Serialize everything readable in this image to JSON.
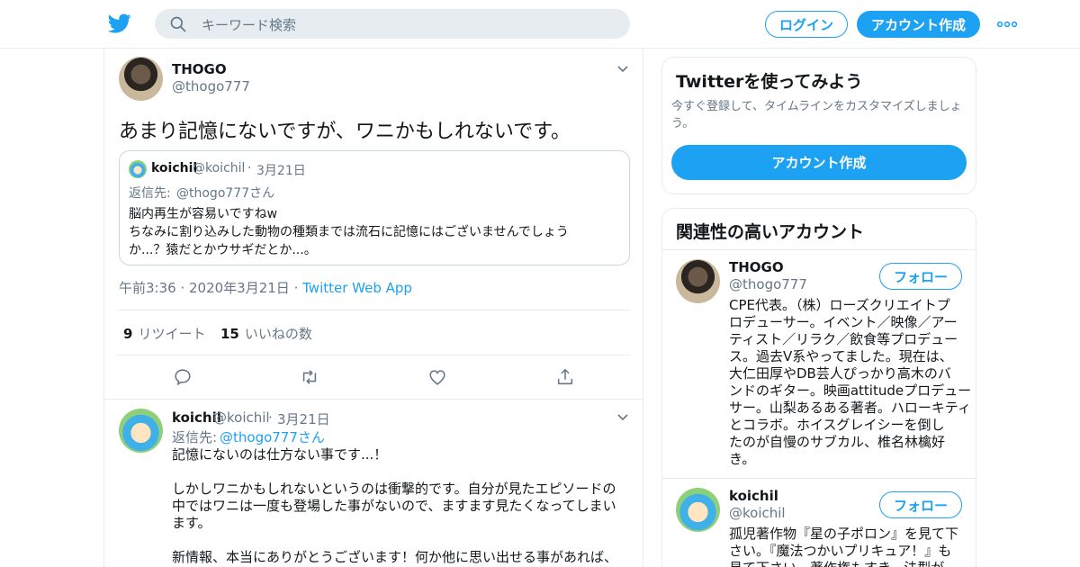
{
  "header": {
    "search_placeholder": "キーワード検索",
    "login_label": "ログイン",
    "signup_label": "アカウント作成"
  },
  "tweet": {
    "author_name": "THOGO",
    "author_handle": "@thogo777",
    "text": "あまり記憶にないですが、ワニかもしれないです。",
    "quote": {
      "name": "koichil",
      "handle": "@koichil",
      "date": "3月21日",
      "reply_prefix": "返信先: ",
      "reply_to": "@thogo777さん",
      "lines": [
        "脳内再生が容易いですねw",
        "ちなみに割り込みした動物の種類までは流石に記憶にはございませんでしょう",
        "か...？猿だとかウサギだとか...。"
      ]
    },
    "time": "午前3:36",
    "date": "2020年3月21日",
    "source": "Twitter Web App",
    "retweet_count": "9",
    "retweet_label": "リツイート",
    "like_count": "15",
    "like_label": "いいねの数"
  },
  "reply": {
    "name": "koichil",
    "handle": "@koichil",
    "date": "3月21日",
    "reply_prefix": "返信先: ",
    "reply_to": "@thogo777さん",
    "lines": [
      "記憶にないのは仕方ない事です...！",
      "",
      "しかしワニかもしれないというのは衝撃的です。自分が見たエピソードの",
      "中ではワニは一度も登場した事がないので、ますます見たくなってしまい",
      "ます。",
      "",
      "新情報、本当にありがとうございます！何か他に思い出せる事があれば、"
    ]
  },
  "sidebar": {
    "signup_card": {
      "title": "Twitterを使ってみよう",
      "desc_lines": [
        "今すぐ登録して、タイムラインをカスタマイズしましょ",
        "う。"
      ],
      "button": "アカウント作成"
    },
    "related": {
      "title": "関連性の高いアカウント",
      "follow_label": "フォロー",
      "accounts": [
        {
          "name": "THOGO",
          "handle": "@thogo777",
          "bio_lines": [
            "CPE代表。（株）ローズクリエイトプ",
            "ロデューサー。イベント／映像／アー",
            "ティスト／リラク／飲食等プロデュー",
            "ス。過去V系やってました。現在は、",
            "大仁田厚やDB芸人ぴっかり高木のバ",
            "ンドのギター。映画attitudeプロデュー",
            "サー。山梨あるある著者。ハローキティ",
            "とコラボ。ホイスグレイシーを倒し",
            "たのが自慢のサブカル、椎名林檎好",
            "き。"
          ]
        },
        {
          "name": "koichil",
          "handle": "@koichil",
          "bio_lines": [
            "孤児著作物『星の子ポロン』を見て下",
            "さい。『魔法つかいプリキュア！』も",
            "見て下さい。著作権もすき。法型が"
          ]
        }
      ]
    }
  },
  "colors": {
    "accent": "#1da1f2",
    "text": "#14171a",
    "secondary": "#657786",
    "border": "#e6ecf0"
  },
  "icons": [
    "twitter-bird-icon",
    "search-icon",
    "more-dots-icon",
    "chevron-down-icon",
    "reply-icon",
    "retweet-icon",
    "like-icon",
    "share-icon"
  ]
}
